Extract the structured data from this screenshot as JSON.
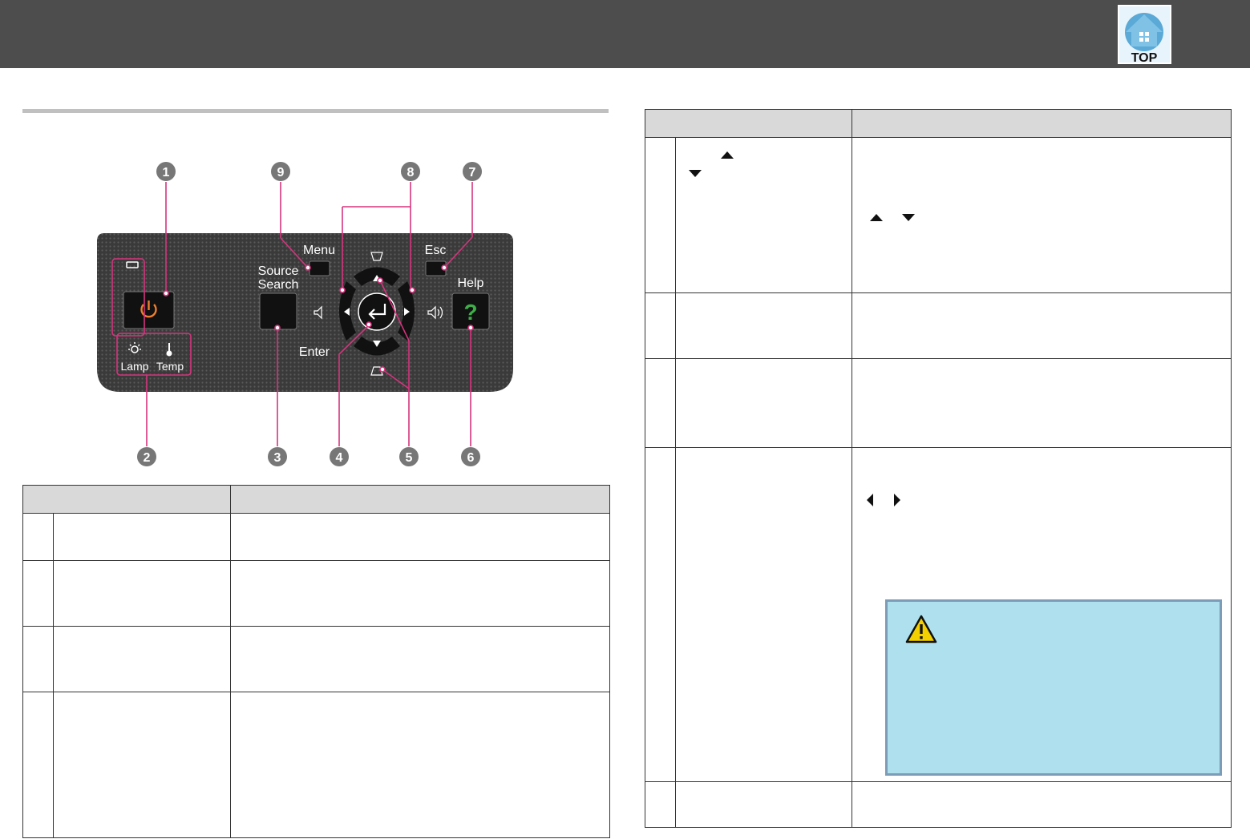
{
  "header": {
    "top_label": "TOP"
  },
  "panel": {
    "callouts": [
      "1",
      "9",
      "8",
      "7",
      "2",
      "3",
      "4",
      "5",
      "6"
    ],
    "labels": {
      "menu": "Menu",
      "source_line1": "Source",
      "source_line2": "Search",
      "esc": "Esc",
      "help": "Help",
      "help_symbol": "?",
      "enter": "Enter",
      "lamp": "Lamp",
      "temp": "Temp"
    }
  },
  "colors": {
    "header_bg": "#4d4d4d",
    "callout_line": "#d6337d",
    "panel_body": "#3a3a3a",
    "caution_bg": "#aee0ee",
    "power_symbol": "#f07f2c",
    "help_symbol": "#3fae49"
  },
  "icons": [
    "top-home-icon",
    "power-icon",
    "arrow-up-icon",
    "arrow-down-icon",
    "arrow-left-icon",
    "arrow-right-icon",
    "warning-icon"
  ]
}
